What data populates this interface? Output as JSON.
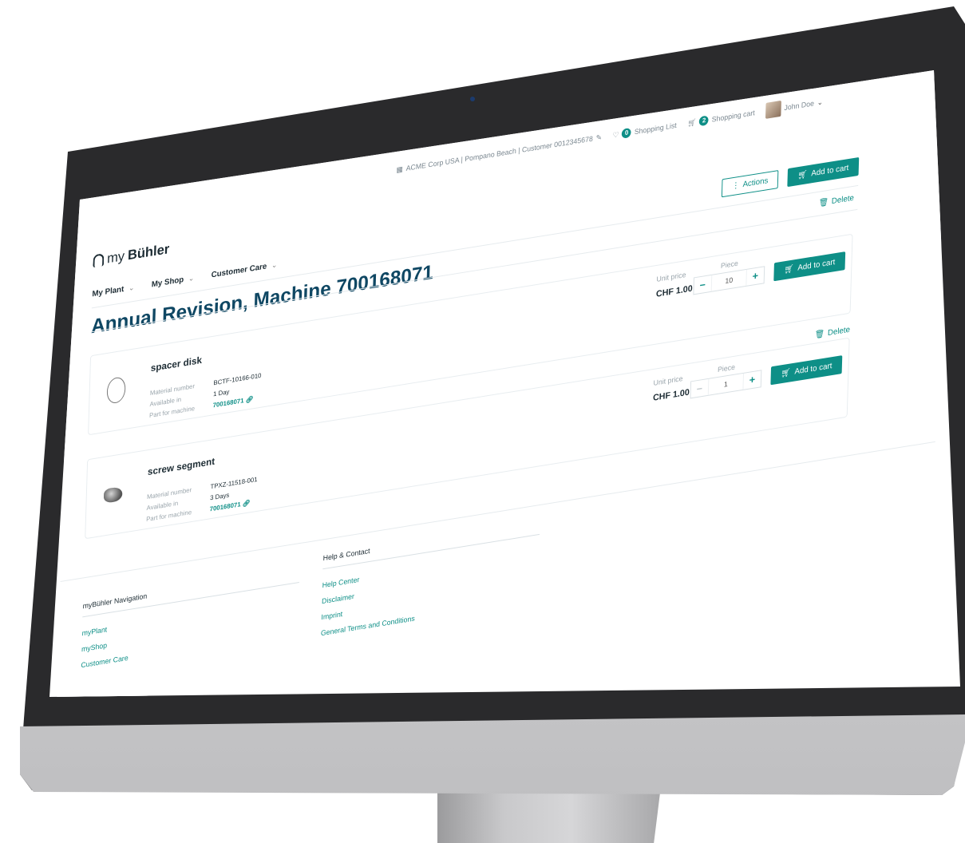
{
  "topbar": {
    "company": "ACME Corp USA | Pompano Beach | Customer 0012345678",
    "shopping_list_label": "Shopping List",
    "shopping_list_count": "0",
    "cart_label": "Shopping cart",
    "cart_count": "2",
    "user_name": "John Doe"
  },
  "logo": {
    "prefix": "my",
    "brand": "Bühler"
  },
  "nav": {
    "items": [
      {
        "label": "My Plant"
      },
      {
        "label": "My Shop"
      },
      {
        "label": "Customer Care"
      }
    ]
  },
  "header_actions": {
    "actions_label": "Actions",
    "add_to_cart_label": "Add to cart"
  },
  "page": {
    "title": "Annual Revision, Machine 700168071"
  },
  "labels": {
    "delete": "Delete",
    "unit_price": "Unit price",
    "piece": "Piece",
    "material_number": "Material number",
    "available_in": "Available in",
    "part_for_machine": "Part for machine",
    "add_to_cart": "Add to cart",
    "minus": "–",
    "plus": "+"
  },
  "items": [
    {
      "name": "spacer disk",
      "material_number": "BCTF-10166-010",
      "available_in": "1 Day",
      "machine": "700168071",
      "price": "CHF 1.00",
      "quantity": "10"
    },
    {
      "name": "screw segment",
      "material_number": "TPXZ-11518-001",
      "available_in": "3 Days",
      "machine": "700168071",
      "price": "CHF 1.00",
      "quantity": "1"
    }
  ],
  "footer": {
    "nav_heading": "myBühler Navigation",
    "nav_links": [
      "myPlant",
      "myShop",
      "Customer Care"
    ],
    "help_heading": "Help & Contact",
    "help_links": [
      "Help Center",
      "Disclaimer",
      "Imprint",
      "General Terms and Conditions"
    ]
  },
  "colors": {
    "accent": "#0e8f87",
    "title": "#0f4763",
    "bezel": "#2a2a2c"
  }
}
